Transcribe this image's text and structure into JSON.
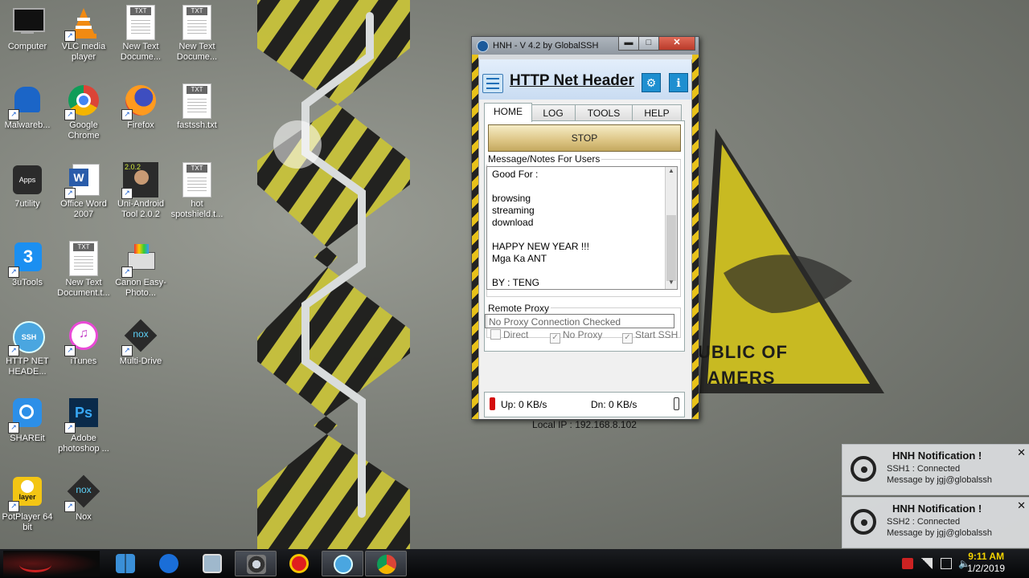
{
  "desktop_icons": [
    {
      "label": "Computer",
      "icon": "computer-icon"
    },
    {
      "label": "VLC media player",
      "icon": "vlc-icon"
    },
    {
      "label": "New Text Docume...",
      "icon": "text-file-icon",
      "badge": "TXT"
    },
    {
      "label": "New Text Docume...",
      "icon": "text-file-icon",
      "badge": "TXT"
    },
    {
      "label": "Malwareb...",
      "icon": "malwarebytes-icon"
    },
    {
      "label": "Google Chrome",
      "icon": "chrome-icon"
    },
    {
      "label": "Firefox",
      "icon": "firefox-icon"
    },
    {
      "label": "fastssh.txt",
      "icon": "text-file-icon",
      "badge": "TXT"
    },
    {
      "label": "7utility",
      "icon": "apps-icon",
      "badge": "Apps"
    },
    {
      "label": "Office Word 2007",
      "icon": "word-icon",
      "badge": "W"
    },
    {
      "label": "Uni-Android Tool 2.0.2",
      "icon": "android-tool-icon",
      "badge": "2.0.2"
    },
    {
      "label": "hot spotshield.t...",
      "icon": "text-file-icon",
      "badge": "TXT"
    },
    {
      "label": "3uTools",
      "icon": "3utools-icon",
      "badge": "3"
    },
    {
      "label": "New Text Document.t...",
      "icon": "text-file-icon",
      "badge": "TXT"
    },
    {
      "label": "Canon Easy-Photo...",
      "icon": "canon-icon"
    },
    {
      "label": "HTTP NET HEADE...",
      "icon": "ssh-icon",
      "badge": "SSH"
    },
    {
      "label": "iTunes",
      "icon": "itunes-icon"
    },
    {
      "label": "Multi-Drive",
      "icon": "nox-multidrive-icon",
      "badge": "nox"
    },
    {
      "label": "SHAREit",
      "icon": "shareit-icon"
    },
    {
      "label": "Adobe photoshop ...",
      "icon": "photoshop-icon",
      "badge": "Ps"
    },
    {
      "label": "PotPlayer 64 bit",
      "icon": "potplayer-icon",
      "badge": "layer"
    },
    {
      "label": "Nox",
      "icon": "nox-icon",
      "badge": "nox"
    }
  ],
  "wallpaper": {
    "text_line1": "UBLIC OF",
    "text_line2": "AMERS"
  },
  "window": {
    "title": "HNH - V 4.2 by GlobalSSH",
    "minimize": "▬",
    "maximize": "□",
    "close": "✕",
    "app_title": "HTTP Net Header",
    "tabs": [
      "HOME",
      "LOG",
      "TOOLS",
      "HELP"
    ],
    "active_tab": "HOME",
    "stop_label": "STOP",
    "notes_label": "Message/Notes For Users",
    "notes_lines": [
      "Good For :",
      "",
      "browsing",
      "streaming",
      "download",
      "",
      "HAPPY NEW YEAR !!!",
      "Mga Ka ANT",
      "",
      "BY : TENG"
    ],
    "remote_proxy_label": "Remote Proxy",
    "remote_proxy_value": "No Proxy Connection Checked",
    "options": [
      {
        "label": "Direct",
        "checked": false
      },
      {
        "label": "No Proxy",
        "checked": true
      },
      {
        "label": "Start SSH",
        "checked": true
      }
    ],
    "up": "Up: 0 KB/s",
    "down": "Dn: 0 KB/s",
    "local_ip": "Local IP : 192.168.8.102",
    "accent": "#1e8fd0"
  },
  "notifications": [
    {
      "title": "HNH Notification !",
      "line1": "SSH1 : Connected",
      "line2": "Message by jgj@globalssh"
    },
    {
      "title": "HNH Notification !",
      "line1": "SSH2 : Connected",
      "line2": "Message by jgj@globalssh"
    }
  ],
  "taskbar": {
    "apps": [
      "start-menu",
      "window-manager",
      "media-player",
      "explorer",
      "camera",
      "record",
      "http-net-header",
      "chrome"
    ],
    "time": "9:11 AM",
    "date": "1/2/2019"
  }
}
